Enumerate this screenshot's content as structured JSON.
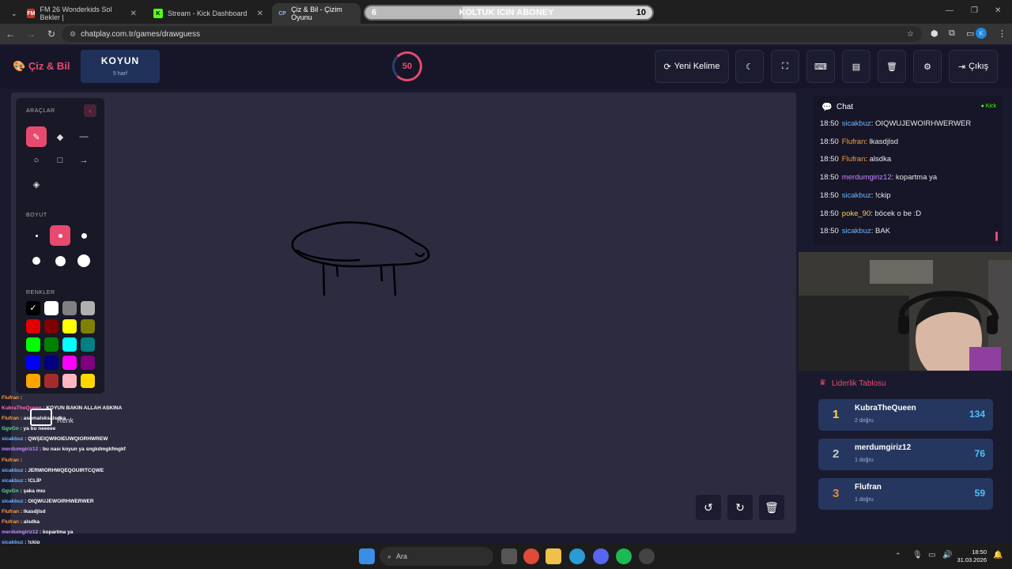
{
  "browser": {
    "tabs": [
      {
        "label": "FM 26 Wonderkids Sol Bekler |",
        "fav": "FM"
      },
      {
        "label": "Stream - Kick Dashboard",
        "fav": "K"
      },
      {
        "label": "Çiz & Bil - Çizim Oyunu",
        "fav": "CP"
      }
    ],
    "url": "chatplay.com.tr/games/drawguess",
    "overlay": {
      "start": "6",
      "text": "KOLTUK ICIN ABONEY",
      "end": "10",
      "progress": 0.34
    },
    "profile_initial": "K"
  },
  "header": {
    "brand": "Çiz & Bil",
    "word": "KOYUN",
    "word_hint": "5 harf",
    "timer": "50",
    "new_word": "Yeni Kelime",
    "exit": "Çıkış"
  },
  "tools": {
    "tools_label": "ARAÇLAR",
    "size_label": "BOYUT",
    "colors_label": "RENKLER",
    "colors": [
      "#000000",
      "#ffffff",
      "#808080",
      "#b0b0b0",
      "#e00000",
      "#800000",
      "#ffff00",
      "#808000",
      "#00ff00",
      "#008000",
      "#00ffff",
      "#008080",
      "#0000ff",
      "#000080",
      "#ff00ff",
      "#800080",
      "#ffa500",
      "#a52a2a",
      "#ffb6c1",
      "#ffd700"
    ],
    "custom_color_label": "Renk"
  },
  "stream_chat": [
    {
      "user": "Flufran",
      "text": " : ",
      "color": "#ff9a3c"
    },
    {
      "user": "KubraTheQueen",
      "text": " : KOYUN BAKIN ALLAH ASKINA",
      "color": "#ff6fb5"
    },
    {
      "user": "Flufran",
      "text": " : asnmalsksalsdka",
      "color": "#ff9a3c"
    },
    {
      "user": "GgvGn",
      "text": " : ya bu neeeee",
      "color": "#4fe08a"
    },
    {
      "user": "sicakbuz",
      "text": " : QWŞEIQW9OIEUWQIORHWREW",
      "color": "#6fb7ff"
    },
    {
      "user": "merdumgiriz12",
      "text": " : bu nası koyun ya sngkdmgkfmgkf",
      "color": "#c98bff"
    },
    {
      "user": "Flufran",
      "text": " : ",
      "color": "#ff9a3c"
    },
    {
      "user": "sicakbuz",
      "text": " : JERWIORHWQEQOUIRTCQWE",
      "color": "#6fb7ff"
    },
    {
      "user": "sicakbuz",
      "text": " : !CLİP",
      "color": "#6fb7ff"
    },
    {
      "user": "GgvGn",
      "text": " : şaka mıu",
      "color": "#4fe08a"
    },
    {
      "user": "sicakbuz",
      "text": " : OIQWUJEWOIRHWERWER",
      "color": "#6fb7ff"
    },
    {
      "user": "Flufran",
      "text": " : lkasdjlsd",
      "color": "#ff9a3c"
    },
    {
      "user": "Flufran",
      "text": " : alsdka",
      "color": "#ff9a3c"
    },
    {
      "user": "merdumgiriz12",
      "text": " : kopartma ya",
      "color": "#c98bff"
    },
    {
      "user": "sicakbuz",
      "text": " : !ckip",
      "color": "#6fb7ff"
    },
    {
      "user": "poke_90",
      "text": " : böcek o be :D",
      "color": "#ffce5c"
    },
    {
      "user": "sicakbuz",
      "text": " : BAK",
      "color": "#6fb7ff"
    }
  ],
  "chat": {
    "title": "Chat",
    "source": "Kick",
    "messages": [
      {
        "time": "18:50",
        "user": "sicakbuz",
        "text": ": OIQWUJEWOIRHWERWER",
        "color": "#6fb7ff"
      },
      {
        "time": "18:50",
        "user": "Flufran",
        "text": ": lkasdjlsd",
        "color": "#ff9a3c"
      },
      {
        "time": "18:50",
        "user": "Flufran",
        "text": ": alsdka",
        "color": "#ff9a3c"
      },
      {
        "time": "18:50",
        "user": "merdumgiriz12",
        "text": ": kopartma ya",
        "color": "#c98bff"
      },
      {
        "time": "18:50",
        "user": "sicakbuz",
        "text": ": !ckip",
        "color": "#6fb7ff"
      },
      {
        "time": "18:50",
        "user": "poke_90",
        "text": ": böcek o be :D",
        "color": "#ffce5c"
      },
      {
        "time": "18:50",
        "user": "sicakbuz",
        "text": ": BAK",
        "color": "#6fb7ff"
      }
    ]
  },
  "leaderboard": {
    "title": "Liderlik Tablosu",
    "rows": [
      {
        "rank": "1",
        "name": "KubraTheQueen",
        "sub": "2 doğru",
        "score": "134",
        "rank_color": "#ffd54a"
      },
      {
        "rank": "2",
        "name": "merdumgiriz12",
        "sub": "1 doğru",
        "score": "76",
        "rank_color": "#c8c8c8"
      },
      {
        "rank": "3",
        "name": "Flufran",
        "sub": "1 doğru",
        "score": "59",
        "rank_color": "#e08a3c"
      }
    ]
  },
  "taskbar": {
    "search": "Ara",
    "time": "18:50",
    "date": "31.03.2026"
  }
}
